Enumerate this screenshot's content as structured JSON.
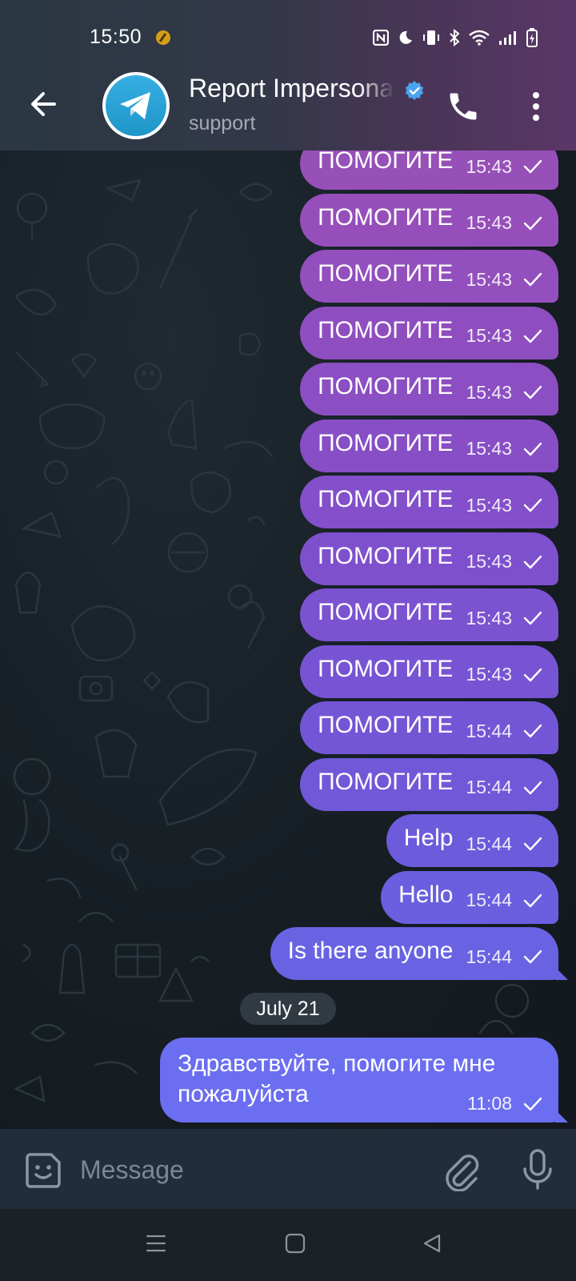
{
  "status_bar": {
    "time": "15:50",
    "icons": [
      "nfc-icon",
      "do-not-disturb-icon",
      "vibrate-icon",
      "bluetooth-icon",
      "wifi-icon",
      "signal-icon",
      "battery-charging-icon"
    ]
  },
  "header": {
    "title": "Report Impersonation",
    "subtitle": "support",
    "verified": true
  },
  "messages": [
    {
      "text": "ПОМОГИТЕ",
      "time": "15:43",
      "color": "#9650b8"
    },
    {
      "text": "ПОМОГИТЕ",
      "time": "15:43",
      "color": "#964fba"
    },
    {
      "text": "ПОМОГИТЕ",
      "time": "15:43",
      "color": "#934fbd"
    },
    {
      "text": "ПОМОГИТЕ",
      "time": "15:43",
      "color": "#8f4ec0"
    },
    {
      "text": "ПОМОГИТЕ",
      "time": "15:43",
      "color": "#8b4ec3"
    },
    {
      "text": "ПОМОГИТЕ",
      "time": "15:43",
      "color": "#874ec6"
    },
    {
      "text": "ПОМОГИТЕ",
      "time": "15:43",
      "color": "#834fca"
    },
    {
      "text": "ПОМОГИТЕ",
      "time": "15:43",
      "color": "#7f50cd"
    },
    {
      "text": "ПОМОГИТЕ",
      "time": "15:43",
      "color": "#7b52d0"
    },
    {
      "text": "ПОМОГИТЕ",
      "time": "15:43",
      "color": "#7754d3"
    },
    {
      "text": "ПОМОГИТЕ",
      "time": "15:44",
      "color": "#7356d6"
    },
    {
      "text": "ПОМОГИТЕ",
      "time": "15:44",
      "color": "#7058d9"
    },
    {
      "text": "Help",
      "time": "15:44",
      "color": "#6d5bdc"
    },
    {
      "text": "Hello",
      "time": "15:44",
      "color": "#6b5fdf"
    },
    {
      "text": "Is there anyone",
      "time": "15:44",
      "color": "#6963e3"
    }
  ],
  "date_separator": "July 21",
  "last_message": {
    "text": "Здравствуйте, помогите мне пожалуйста",
    "time": "11:08"
  },
  "input": {
    "placeholder": "Message"
  },
  "colors": {
    "header_left": "#2b3743",
    "header_right": "#5b3768",
    "wallpaper": "#161e24",
    "input_bar": "#212d3b",
    "last_bubble": "#6b6ef0"
  }
}
